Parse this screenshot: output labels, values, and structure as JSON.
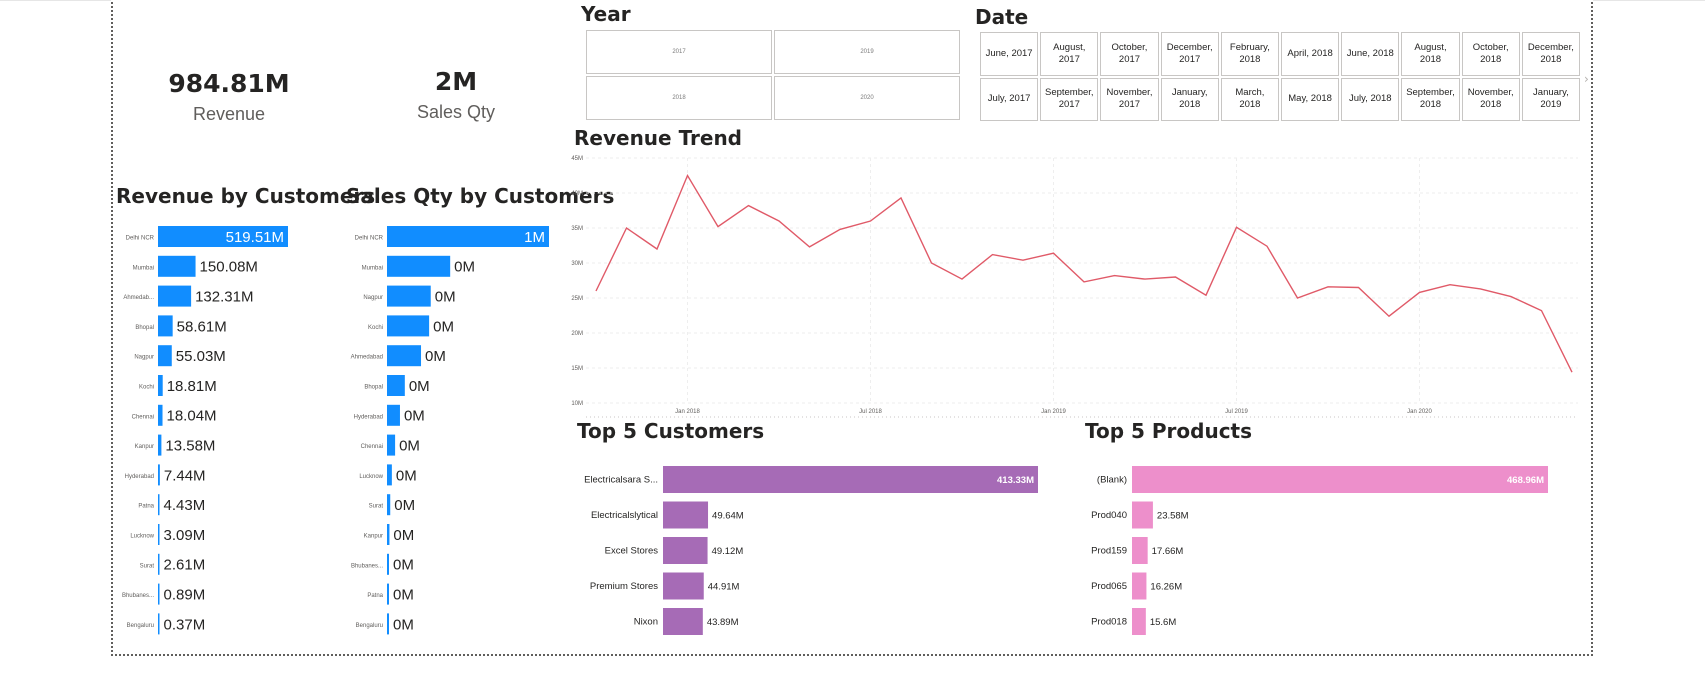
{
  "kpis": {
    "revenue": {
      "value": "984.81M",
      "label": "Revenue"
    },
    "sales_qty": {
      "value": "2M",
      "label": "Sales Qty"
    }
  },
  "slicers": {
    "year": {
      "title": "Year",
      "items": [
        "2017",
        "2019",
        "2018",
        "2020"
      ]
    },
    "date": {
      "title": "Date",
      "items": [
        "June, 2017",
        "August, 2017",
        "October, 2017",
        "December, 2017",
        "February, 2018",
        "April, 2018",
        "June, 2018",
        "August, 2018",
        "October, 2018",
        "December, 2018",
        "July, 2017",
        "September, 2017",
        "November, 2017",
        "January, 2018",
        "March, 2018",
        "May, 2018",
        "July, 2018",
        "September, 2018",
        "November, 2018",
        "January, 2019"
      ],
      "scroll_icon": "chevron-right-icon"
    }
  },
  "colors": {
    "blue": "#118DFF",
    "purple": "#A66BB6",
    "pink": "#ED8FCB",
    "line": "#E05A68"
  },
  "chart_data": [
    {
      "id": "revenue_by_customers",
      "type": "bar",
      "orientation": "horizontal",
      "title": "Revenue by Customers",
      "categories": [
        "Delhi NCR",
        "Mumbai",
        "Ahmedab...",
        "Bhopal",
        "Nagpur",
        "Kochi",
        "Chennai",
        "Kanpur",
        "Hyderabad",
        "Patna",
        "Lucknow",
        "Surat",
        "Bhubanes...",
        "Bengaluru"
      ],
      "values": [
        519.51,
        150.08,
        132.31,
        58.61,
        55.03,
        18.81,
        18.04,
        13.58,
        7.44,
        4.43,
        3.09,
        2.61,
        0.89,
        0.37
      ],
      "labels": [
        "519.51M",
        "150.08M",
        "132.31M",
        "58.61M",
        "55.03M",
        "18.81M",
        "18.04M",
        "13.58M",
        "7.44M",
        "4.43M",
        "3.09M",
        "2.61M",
        "0.89M",
        "0.37M"
      ],
      "color": "#118DFF"
    },
    {
      "id": "sales_qty_by_customers",
      "type": "bar",
      "orientation": "horizontal",
      "title": "Sales Qty by Customers",
      "categories": [
        "Delhi NCR",
        "Mumbai",
        "Nagpur",
        "Kochi",
        "Ahmedabad",
        "Bhopal",
        "Hyderabad",
        "Chennai",
        "Lucknow",
        "Surat",
        "Kanpur",
        "Bhubanes...",
        "Patna",
        "Bengaluru"
      ],
      "values": [
        1.0,
        0.39,
        0.27,
        0.26,
        0.21,
        0.11,
        0.08,
        0.05,
        0.03,
        0.02,
        0.015,
        0.01,
        0.008,
        0.005
      ],
      "labels": [
        "1M",
        "0M",
        "0M",
        "0M",
        "0M",
        "0M",
        "0M",
        "0M",
        "0M",
        "0M",
        "0M",
        "0M",
        "0M",
        "0M"
      ],
      "color": "#118DFF"
    },
    {
      "id": "revenue_trend",
      "type": "line",
      "title": "Revenue Trend",
      "x": [
        "2017-10",
        "2017-11",
        "2017-12",
        "2018-01",
        "2018-02",
        "2018-03",
        "2018-04",
        "2018-05",
        "2018-06",
        "2018-07",
        "2018-08",
        "2018-09",
        "2018-10",
        "2018-11",
        "2018-12",
        "2019-01",
        "2019-02",
        "2019-03",
        "2019-04",
        "2019-05",
        "2019-06",
        "2019-07",
        "2019-08",
        "2019-09",
        "2019-10",
        "2019-11",
        "2019-12",
        "2020-01",
        "2020-02",
        "2020-03",
        "2020-04",
        "2020-05",
        "2020-06"
      ],
      "values": [
        26,
        35,
        32,
        42.5,
        35.2,
        38.2,
        36,
        32.3,
        34.8,
        36,
        39.3,
        30,
        27.7,
        31.2,
        30.4,
        31.4,
        27.3,
        28.2,
        27.7,
        28,
        25.4,
        35.1,
        32.4,
        25,
        26.6,
        26.5,
        22.4,
        25.8,
        26.9,
        26.3,
        25.2,
        23.2,
        14.4
      ],
      "y_ticks": [
        "10M",
        "15M",
        "20M",
        "25M",
        "30M",
        "35M",
        "40M",
        "45M"
      ],
      "ylim": [
        10,
        45
      ],
      "x_ticks": [
        "Jan 2018",
        "Jul 2018",
        "Jan 2019",
        "Jul 2019",
        "Jan 2020"
      ],
      "grid": true,
      "color": "#E05A68"
    },
    {
      "id": "top5_customers",
      "type": "bar",
      "orientation": "horizontal",
      "title": "Top 5 Customers",
      "categories": [
        "Electricalsara S...",
        "Electricalslytical",
        "Excel Stores",
        "Premium Stores",
        "Nixon"
      ],
      "values": [
        413.33,
        49.64,
        49.12,
        44.91,
        43.89
      ],
      "labels": [
        "413.33M",
        "49.64M",
        "49.12M",
        "44.91M",
        "43.89M"
      ],
      "color": "#A66BB6"
    },
    {
      "id": "top5_products",
      "type": "bar",
      "orientation": "horizontal",
      "title": "Top 5 Products",
      "categories": [
        "(Blank)",
        "Prod040",
        "Prod159",
        "Prod065",
        "Prod018"
      ],
      "values": [
        468.96,
        23.58,
        17.66,
        16.26,
        15.6
      ],
      "labels": [
        "468.96M",
        "23.58M",
        "17.66M",
        "16.26M",
        "15.6M"
      ],
      "color": "#ED8FCB"
    }
  ]
}
